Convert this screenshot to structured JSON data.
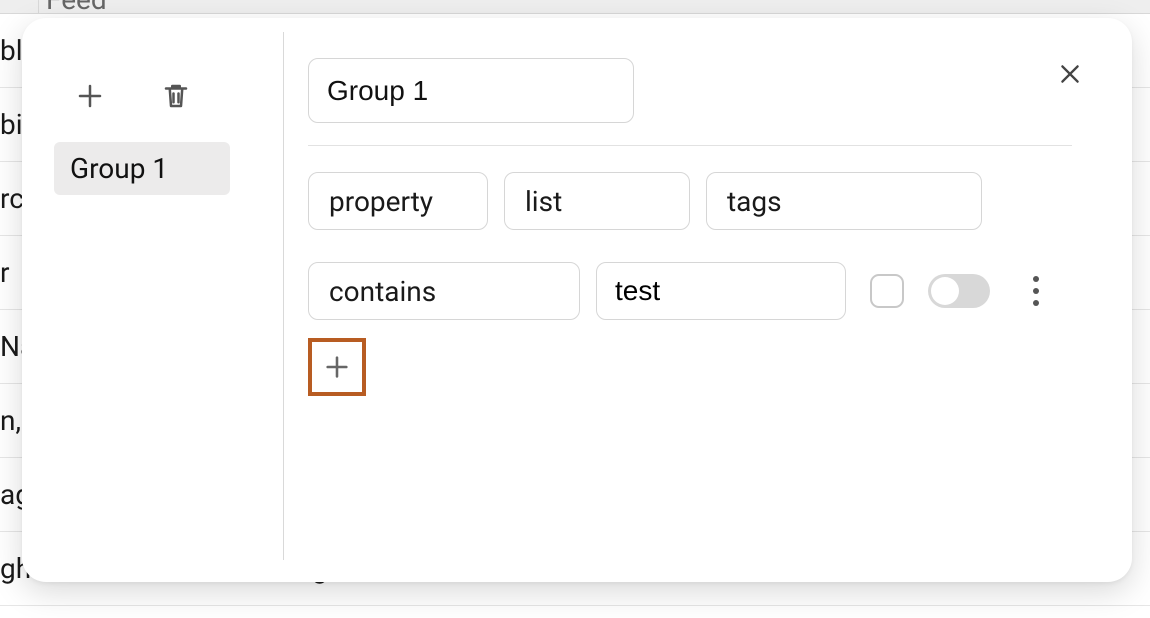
{
  "background": {
    "header_col": "Feed",
    "rows": [
      "bli",
      "bi",
      "rc",
      "r",
      "Na",
      "n,",
      "ag",
      "gham Palace, London, England"
    ]
  },
  "dialog": {
    "group_name": "Group 1",
    "sidebar": {
      "items": [
        {
          "label": "Group 1"
        }
      ]
    },
    "rule": {
      "field_type": "property",
      "list": "list",
      "property": "tags",
      "operator": "contains",
      "value": "test",
      "checked": false,
      "toggle_on": false
    },
    "highlight_color": "#b85c22"
  }
}
